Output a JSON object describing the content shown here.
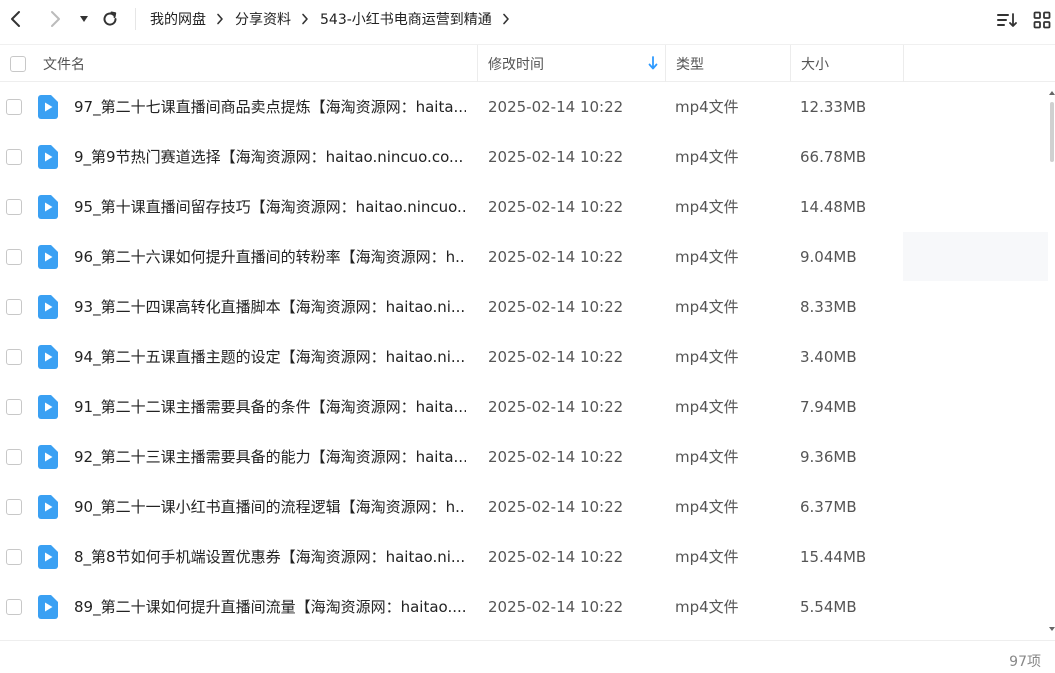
{
  "breadcrumb": [
    "我的网盘",
    "分享资料",
    "543-小红书电商运营到精通"
  ],
  "columns": {
    "name": "文件名",
    "mtime": "修改时间",
    "type": "类型",
    "size": "大小"
  },
  "files": [
    {
      "name": "97_第二十七课直播间商品卖点提炼【海淘资源网：haita...",
      "mtime": "2025-02-14 10:22",
      "type": "mp4文件",
      "size": "12.33MB"
    },
    {
      "name": "9_第9节热门赛道选择【海淘资源网：haitao.nincuo.co...",
      "mtime": "2025-02-14 10:22",
      "type": "mp4文件",
      "size": "66.78MB"
    },
    {
      "name": "95_第十课直播间留存技巧【海淘资源网：haitao.nincuo...",
      "mtime": "2025-02-14 10:22",
      "type": "mp4文件",
      "size": "14.48MB"
    },
    {
      "name": "96_第二十六课如何提升直播间的转粉率【海淘资源网：h...",
      "mtime": "2025-02-14 10:22",
      "type": "mp4文件",
      "size": "9.04MB"
    },
    {
      "name": "93_第二十四课高转化直播脚本【海淘资源网：haitao.ni...",
      "mtime": "2025-02-14 10:22",
      "type": "mp4文件",
      "size": "8.33MB"
    },
    {
      "name": "94_第二十五课直播主题的设定【海淘资源网：haitao.ni...",
      "mtime": "2025-02-14 10:22",
      "type": "mp4文件",
      "size": "3.40MB"
    },
    {
      "name": "91_第二十二课主播需要具备的条件【海淘资源网：haita...",
      "mtime": "2025-02-14 10:22",
      "type": "mp4文件",
      "size": "7.94MB"
    },
    {
      "name": "92_第二十三课主播需要具备的能力【海淘资源网：haita...",
      "mtime": "2025-02-14 10:22",
      "type": "mp4文件",
      "size": "9.36MB"
    },
    {
      "name": "90_第二十一课小红书直播间的流程逻辑【海淘资源网：h...",
      "mtime": "2025-02-14 10:22",
      "type": "mp4文件",
      "size": "6.37MB"
    },
    {
      "name": "8_第8节如何手机端设置优惠券【海淘资源网：haitao.ni...",
      "mtime": "2025-02-14 10:22",
      "type": "mp4文件",
      "size": "15.44MB"
    },
    {
      "name": "89_第二十课如何提升直播间流量【海淘资源网：haitao....",
      "mtime": "2025-02-14 10:22",
      "type": "mp4文件",
      "size": "5.54MB"
    }
  ],
  "footer": {
    "count": "97项"
  },
  "colors": {
    "accent": "#2f9bff",
    "icon_blue": "#3aa0f3"
  },
  "icons": {
    "back": "chevron-left-icon",
    "forward": "chevron-right-icon",
    "history": "caret-down-icon",
    "refresh": "refresh-icon",
    "sort": "sort-icon",
    "view": "grid-view-icon",
    "file": "video-file-icon"
  }
}
